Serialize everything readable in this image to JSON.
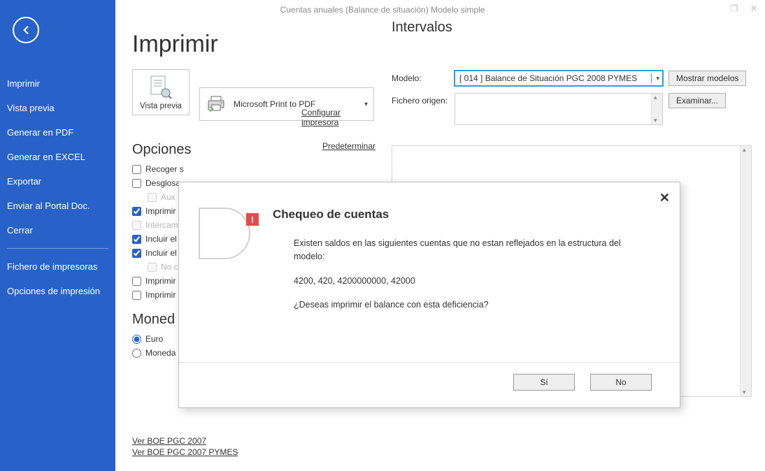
{
  "window": {
    "title": "Cuentas anuales (Balance de situación) Modelo simple"
  },
  "sidebar": {
    "items": [
      "Imprimir",
      "Vista previa",
      "Generar en PDF",
      "Generar en EXCEL",
      "Exportar",
      "Enviar al Portal Doc.",
      "Cerrar"
    ],
    "secondary": [
      "Fichero de impresoras",
      "Opciones de impresión"
    ]
  },
  "page": {
    "heading": "Imprimir",
    "preview_button": "Vista previa",
    "printer_name": "Microsoft Print to PDF",
    "link_configure": "Configurar impresora",
    "link_default": "Predeterminar",
    "opciones_heading": "Opciones",
    "options": {
      "recoger": "Recoger s",
      "desglosa": "Desglosa",
      "aux": "Aux",
      "imprimir_e1": "Imprimir e",
      "intercamb": "Intercamb",
      "incluir_s": "Incluir el s",
      "incluir_2": "Incluir el ",
      "no_c": "No c",
      "imprimir_s": "Imprimir s",
      "imprimir_e2": "Imprimir e"
    },
    "moneda_heading": "Moned",
    "moneda_euro": "Euro",
    "moneda_otra": "Moneda",
    "ver_boe1": "Ver BOE PGC 2007",
    "ver_boe2": "Ver BOE PGC 2007 PYMES"
  },
  "intervalos": {
    "heading": "Intervalos",
    "modelo_label": "Modelo:",
    "modelo_value": "[ 014 ] Balance de Situación PGC 2008 PYMES",
    "mostrar_button": "Mostrar modelos",
    "fichero_label": "Fichero origen:",
    "examinar_button": "Examinar..."
  },
  "dialog": {
    "title": "Chequeo de cuentas",
    "line1": "Existen saldos en las siguientes cuentas que no estan reflejados en la estructura del modelo:",
    "accounts": "4200, 420, 4200000000, 42000",
    "question": "¿Deseas imprimir el balance con esta deficiencia?",
    "yes": "Sí",
    "no": "No"
  }
}
